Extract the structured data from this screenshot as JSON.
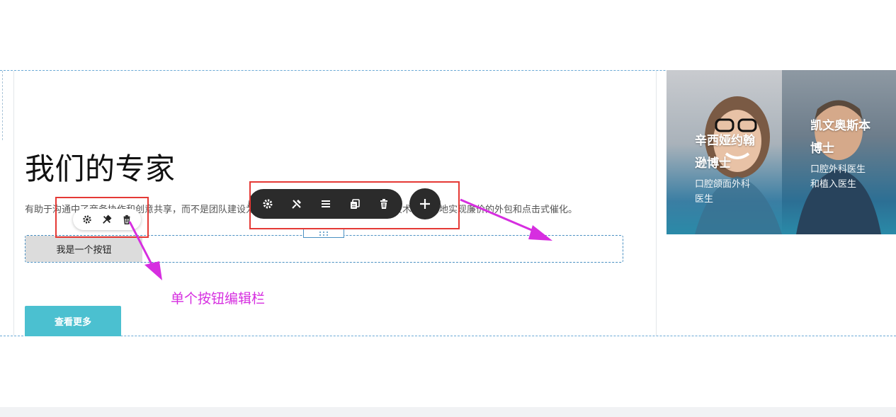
{
  "section": {
    "heading": "我们的专家",
    "description": "有助于沟通中了商务协作和创意共享，而不是团队建设为对象的合作并不像协作和可维护的技术。适当地实现廉价的外包和点击式催化。",
    "selected_button_label": "我是一个按钮",
    "more_button_label": "查看更多"
  },
  "toolbars": {
    "single_button": {
      "icons": [
        "gear-icon",
        "paint-brush-icon",
        "trash-icon"
      ]
    },
    "section": {
      "icons": [
        "gear-icon",
        "paint-brush-icon",
        "list-icon",
        "duplicate-icon",
        "trash-icon"
      ],
      "add_icon": "plus-icon"
    }
  },
  "annotation": {
    "label": "单个按钮编辑栏"
  },
  "experts": [
    {
      "name": "辛西娅约翰逊博士",
      "role": "口腔颌面外科医生"
    },
    {
      "name": "凯文奥斯本博士",
      "role": "口腔外科医生和植入医生"
    }
  ],
  "colors": {
    "accent_teal": "#4bc0d0",
    "toolbar_dark": "#2b2b2b",
    "highlight_red": "#e53935",
    "annotation_magenta": "#d62ee0"
  }
}
